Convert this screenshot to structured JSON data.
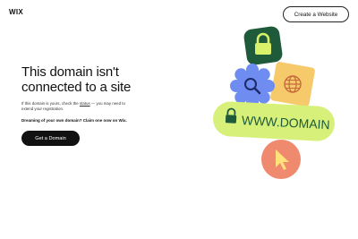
{
  "header": {
    "logo": "WIX",
    "create_button": "Create a Website"
  },
  "main": {
    "headline_line1": "This domain isn't",
    "headline_line2": "connected to a site",
    "body_prefix": "If this domain is yours, check the ",
    "body_link": "status",
    "body_suffix": " — you may need to extend your registration.",
    "dream_text": "Dreaming of your own domain? Claim one now on Wix.",
    "get_domain_button": "Get a Domain"
  },
  "illustration": {
    "domain_label": "WWW.DOMAIN",
    "icons": [
      "lock-icon",
      "search-icon",
      "globe-icon",
      "cursor-icon"
    ]
  },
  "colors": {
    "lock_tile": "#1f5a3a",
    "lock_glyph": "#d8f06a",
    "search_flower": "#6f8cf0",
    "globe_tile": "#f6c96a",
    "domain_pill": "#d6f07a",
    "cursor_circle": "#f08a6e",
    "button_dark": "#111111"
  }
}
